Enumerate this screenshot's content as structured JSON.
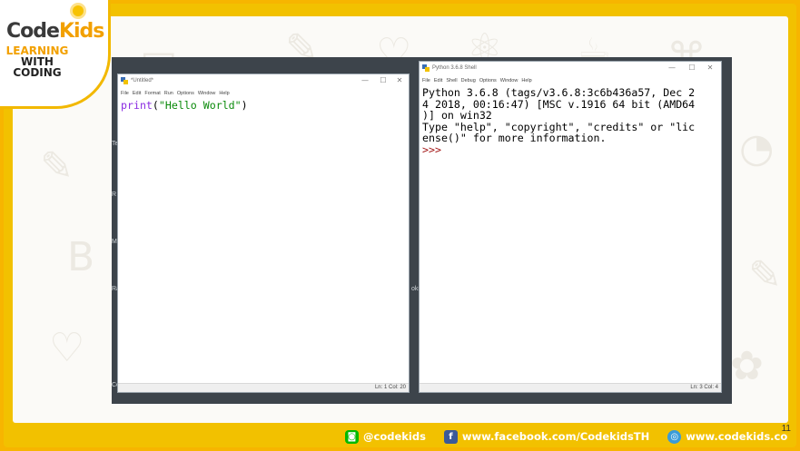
{
  "logo": {
    "brand_a": "Code",
    "brand_b": "Kids",
    "line1": "LEARNING",
    "line2": "WITH",
    "line3": "CODING"
  },
  "editor_window": {
    "title": "*Untitled*",
    "menu": [
      "File",
      "Edit",
      "Format",
      "Run",
      "Options",
      "Window",
      "Help"
    ],
    "code_builtin": "print",
    "code_open": "(",
    "code_string": "\"Hello World\"",
    "code_close": ")",
    "status": "Ln: 1  Col: 20"
  },
  "shell_window": {
    "title": "Python 3.6.8 Shell",
    "menu": [
      "File",
      "Edit",
      "Shell",
      "Debug",
      "Options",
      "Window",
      "Help"
    ],
    "lines": [
      "Python 3.6.8 (tags/v3.6.8:3c6b436a57, Dec 2",
      "4 2018, 00:16:47) [MSC v.1916 64 bit (AMD64",
      ")] on win32",
      "Type \"help\", \"copyright\", \"credits\" or \"lic",
      "ense()\" for more information."
    ],
    "prompt": ">>>",
    "status": "Ln: 3  Col: 4"
  },
  "window_controls": {
    "minimize": "—",
    "maximize": "☐",
    "close": "✕"
  },
  "footer": {
    "line": "@codekids",
    "facebook": "www.facebook.com/CodekidsTH",
    "website": "www.codekids.co"
  },
  "page_number": "11"
}
